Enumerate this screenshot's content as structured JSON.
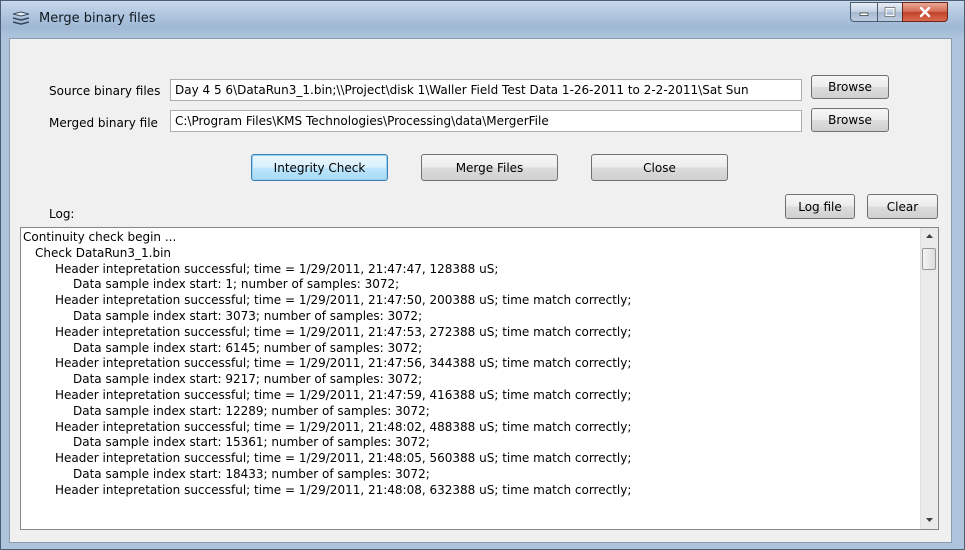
{
  "window": {
    "title": "Merge binary files"
  },
  "source": {
    "label": "Source binary files",
    "value": "Day 4 5 6\\DataRun3_1.bin;\\\\Project\\disk 1\\Waller Field Test Data 1-26-2011 to 2-2-2011\\Sat Sun",
    "browse_label": "Browse"
  },
  "merged": {
    "label": "Merged binary file",
    "value": "C:\\Program Files\\KMS Technologies\\Processing\\data\\MergerFile",
    "browse_label": "Browse"
  },
  "actions": {
    "integrity_label": "Integrity Check",
    "merge_label": "Merge Files",
    "close_label": "Close"
  },
  "log": {
    "label": "Log:",
    "logfile_label": "Log file",
    "clear_label": "Clear",
    "lines": [
      {
        "indent": 0,
        "text": "Continuity check begin ..."
      },
      {
        "indent": 1,
        "text": "Check DataRun3_1.bin"
      },
      {
        "indent": 2,
        "text": "Header intepretation successful; time =  1/29/2011, 21:47:47, 128388 uS;"
      },
      {
        "indent": 3,
        "text": "Data sample index start: 1; number of samples: 3072;"
      },
      {
        "indent": 2,
        "text": "Header intepretation successful; time =  1/29/2011, 21:47:50, 200388 uS; time match correctly;"
      },
      {
        "indent": 3,
        "text": "Data sample index start: 3073; number of samples: 3072;"
      },
      {
        "indent": 2,
        "text": "Header intepretation successful; time =  1/29/2011, 21:47:53, 272388 uS; time match correctly;"
      },
      {
        "indent": 3,
        "text": "Data sample index start: 6145; number of samples: 3072;"
      },
      {
        "indent": 2,
        "text": "Header intepretation successful; time =  1/29/2011, 21:47:56, 344388 uS; time match correctly;"
      },
      {
        "indent": 3,
        "text": "Data sample index start: 9217; number of samples: 3072;"
      },
      {
        "indent": 2,
        "text": "Header intepretation successful; time =  1/29/2011, 21:47:59, 416388 uS; time match correctly;"
      },
      {
        "indent": 3,
        "text": "Data sample index start: 12289; number of samples: 3072;"
      },
      {
        "indent": 2,
        "text": "Header intepretation successful; time =  1/29/2011, 21:48:02, 488388 uS; time match correctly;"
      },
      {
        "indent": 3,
        "text": "Data sample index start: 15361; number of samples: 3072;"
      },
      {
        "indent": 2,
        "text": "Header intepretation successful; time =  1/29/2011, 21:48:05, 560388 uS; time match correctly;"
      },
      {
        "indent": 3,
        "text": "Data sample index start: 18433; number of samples: 3072;"
      },
      {
        "indent": 2,
        "text": "Header intepretation successful; time =  1/29/2011, 21:48:08, 632388 uS; time match correctly;"
      }
    ]
  },
  "icons": {
    "app": "stacked-layers-icon",
    "minimize": "minimize-icon",
    "maximize": "maximize-icon",
    "close": "close-icon",
    "scroll_up": "scroll-up-arrow-icon",
    "scroll_down": "scroll-down-arrow-icon"
  },
  "colors": {
    "title_bar": "#b3c9e1",
    "client_bg": "#f0f0f0",
    "close_button": "#c2412a",
    "focus_accent": "#3c7fb1"
  }
}
